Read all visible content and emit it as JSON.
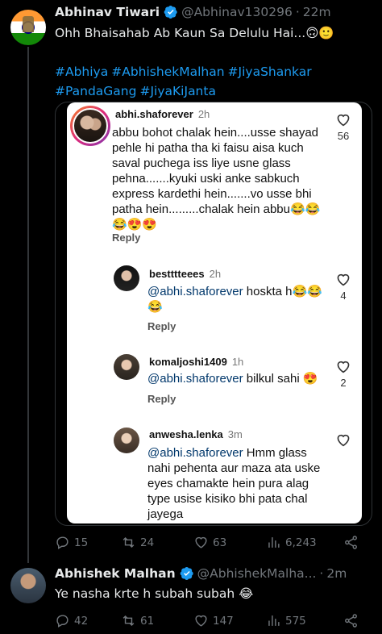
{
  "tweet1": {
    "name": "Abhinav Tiwari",
    "handle": "@Abhinav130296",
    "time": "22m",
    "text": "Ohh Bhaisahab Ab Kaun Sa Delulu Hai...🙃🙂",
    "hashtags": [
      "#Abhiya",
      "#AbhishekMalhan",
      "#JiyaShankar",
      "#PandaGang",
      "#JiyaKiJanta"
    ],
    "stats": {
      "replies": "15",
      "reposts": "24",
      "likes": "63",
      "views": "6,243"
    }
  },
  "instagram": {
    "main": {
      "user": "abhi.shaforever",
      "time": "2h",
      "lines": [
        "abbu bohot chalak hein....usse shayad",
        "pehle hi patha tha ki faisu aisa kuch",
        "saval puchega iss liye usne glass",
        "pehna.......kyuki uski anke sabkuch",
        "express kardethi hein.......vo usse bhi",
        "patha hein.........chalak hein abbu😂😂",
        "😂😍😍"
      ],
      "reply_label": "Reply",
      "likes": "56"
    },
    "replies": [
      {
        "user": "bestttteees",
        "time": "2h",
        "mention": "@abhi.shaforever",
        "line1": " hoskta h😂😂",
        "line2": "😂",
        "reply_label": "Reply",
        "likes": "4"
      },
      {
        "user": "komaljoshi1409",
        "time": "1h",
        "mention": "@abhi.shaforever",
        "line1": " bilkul sahi 😍",
        "reply_label": "Reply",
        "likes": "2"
      },
      {
        "user": "anwesha.lenka",
        "time": "3m",
        "mention": "@abhi.shaforever",
        "line1": " Hmm glass",
        "lines": [
          "nahi pehenta aur maza ata uske",
          "eyes chamakte hein pura alag",
          "type usise kisiko bhi pata chal",
          "jayega"
        ]
      }
    ]
  },
  "tweet2": {
    "name": "Abhishek Malhan",
    "handle": "@AbhishekMalha...",
    "time": "2m",
    "text": "Ye nasha krte h subah subah 😂",
    "stats": {
      "replies": "42",
      "reposts": "61",
      "likes": "147",
      "views": "575"
    }
  },
  "colors": {
    "accent": "#1d9bf0",
    "muted": "#71767b",
    "background": "#000000"
  }
}
